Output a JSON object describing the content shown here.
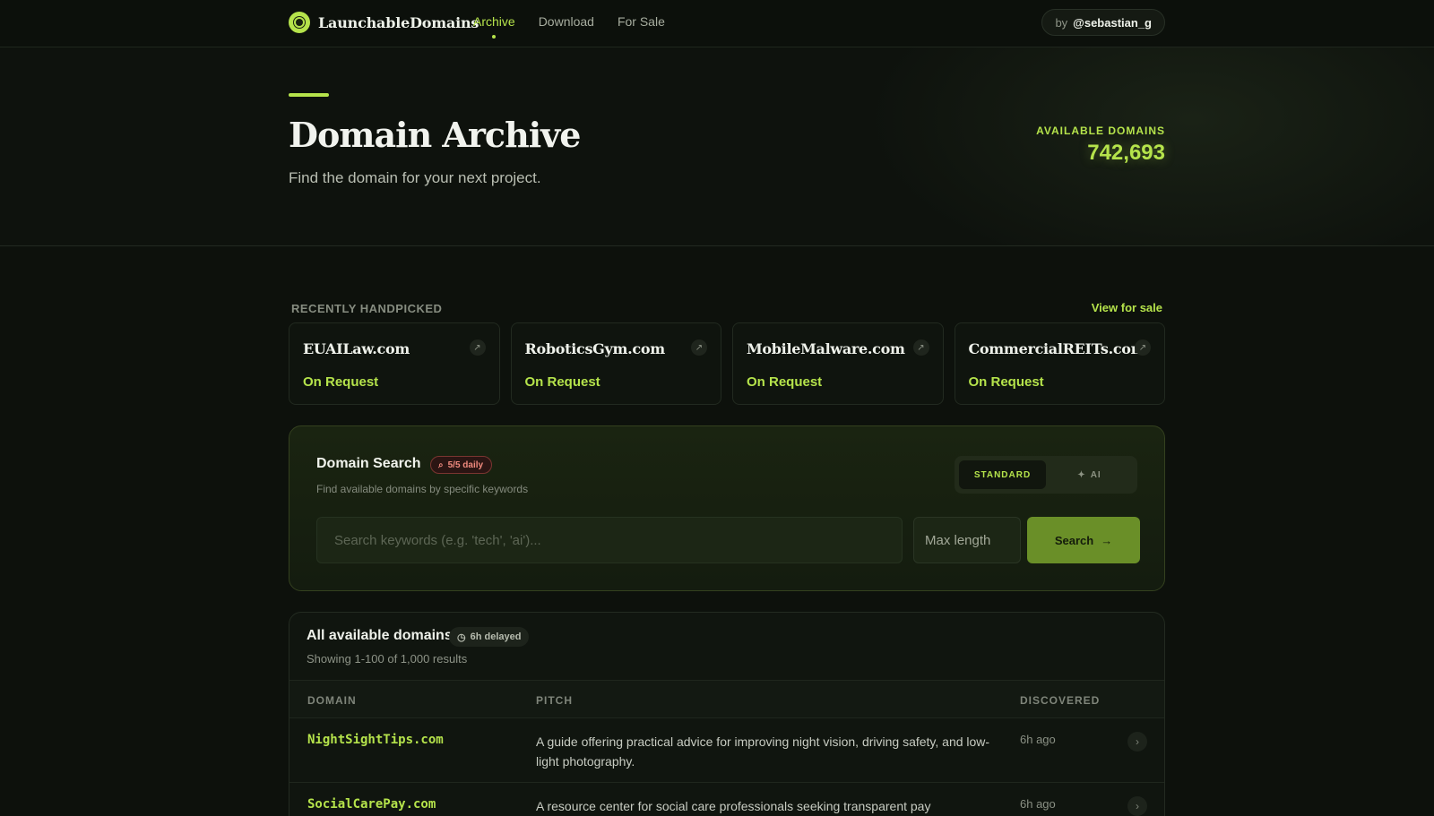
{
  "nav": {
    "brand": "LaunchableDomains",
    "links": [
      "Archive",
      "Download",
      "For Sale"
    ],
    "author_prefix": "by",
    "author_handle": "@sebastian_g"
  },
  "hero": {
    "title": "Domain Archive",
    "subtitle": "Find the domain for your next project.",
    "available_label": "AVAILABLE DOMAINS",
    "available_count": "742,693"
  },
  "handpicked": {
    "label": "RECENTLY HANDPICKED",
    "view_link": "View for sale",
    "cards": [
      {
        "name": "EUAILaw.com",
        "price": "On Request"
      },
      {
        "name": "RoboticsGym.com",
        "price": "On Request"
      },
      {
        "name": "MobileMalware.com",
        "price": "On Request"
      },
      {
        "name": "CommercialREITs.com",
        "price": "On Request"
      }
    ]
  },
  "search": {
    "title": "Domain Search",
    "quota": "5/5 daily",
    "description": "Find available domains by specific keywords",
    "mode_standard": "STANDARD",
    "mode_ai": "AI",
    "keyword_placeholder": "Search keywords (e.g. 'tech', 'ai')...",
    "max_length_placeholder": "Max length",
    "button": "Search"
  },
  "table": {
    "title": "All available domains",
    "delay_badge": "6h delayed",
    "summary": "Showing 1-100 of 1,000 results",
    "columns": [
      "DOMAIN",
      "PITCH",
      "DISCOVERED"
    ],
    "rows": [
      {
        "domain": "NightSightTips.com",
        "pitch": "A guide offering practical advice for improving night vision, driving safety, and low-light photography.",
        "discovered": "6h ago"
      },
      {
        "domain": "SocialCarePay.com",
        "pitch": "A resource center for social care professionals seeking transparent pay",
        "discovered": "6h ago"
      }
    ]
  },
  "colors": {
    "accent": "#b5e34b",
    "background": "#0d110c",
    "quota_badge": "#f08a7e"
  }
}
